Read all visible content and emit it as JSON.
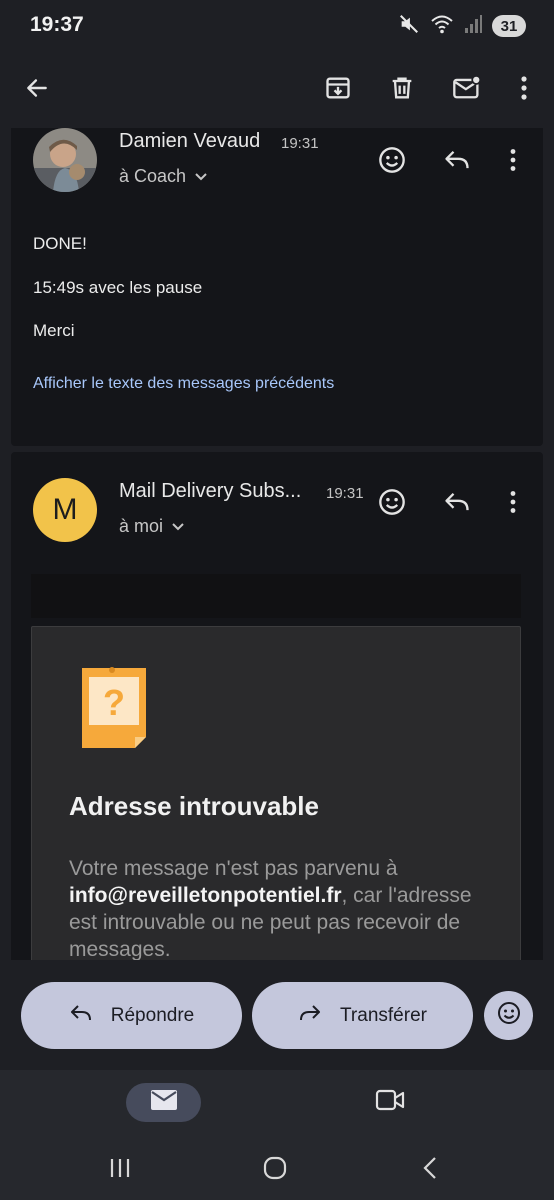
{
  "status_bar": {
    "time": "19:37",
    "battery": "31",
    "icons": [
      "mute-icon",
      "wifi-icon",
      "signal-icon"
    ]
  },
  "toolbar": {
    "back_icon": "arrow-back-icon",
    "actions": [
      "archive-icon",
      "delete-icon",
      "mark-unread-icon",
      "more-vert-icon"
    ]
  },
  "messages": [
    {
      "sender": "Damien Vevaud",
      "time": "19:31",
      "recipient": "à Coach",
      "body": [
        "DONE!",
        "15:49s avec les pause",
        "Merci"
      ],
      "show_quoted": "Afficher le texte des messages précédents"
    },
    {
      "sender": "Mail Delivery Subs...",
      "time": "19:31",
      "recipient": "à moi",
      "avatar_letter": "M",
      "avatar_color": "#f2c34a",
      "ndr_title": "Adresse introuvable",
      "ndr_text_1": "Votre message n'est pas parvenu à ",
      "ndr_email": "info@reveilletonpotentiel.fr",
      "ndr_text_2": ", car l'adresse est introuvable ou ne peut pas recevoir de messages."
    }
  ],
  "actions": {
    "reply_label": "Répondre",
    "forward_label": "Transférer"
  },
  "bottom_nav": {
    "items": [
      "mail-icon",
      "video-call-icon"
    ],
    "selected": "mail-icon"
  },
  "colors": {
    "background": "#1e1f24",
    "card": "#141519",
    "accent_link": "#a8c7fa",
    "pill": "#c4c7dc",
    "nav_active": "#464b5c"
  }
}
